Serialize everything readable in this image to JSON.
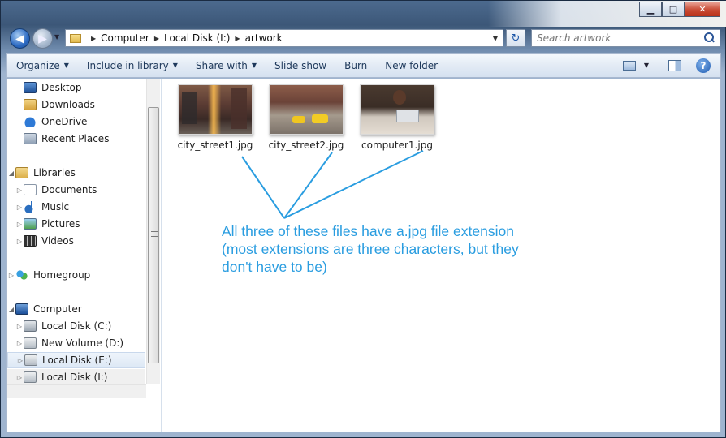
{
  "window": {
    "caption_buttons": {
      "minimize": "▁",
      "maximize": "□",
      "close": "✕"
    }
  },
  "nav": {
    "back_glyph": "◀",
    "forward_glyph": "▶",
    "address": {
      "crumbs": [
        "Computer",
        "Local Disk (I:)",
        "artwork"
      ],
      "separator": "▶"
    },
    "refresh_glyph": "↻",
    "search": {
      "placeholder": "Search artwork"
    }
  },
  "commandbar": {
    "organize": "Organize",
    "include_in_library": "Include in library",
    "share_with": "Share with",
    "slide_show": "Slide show",
    "burn": "Burn",
    "new_folder": "New folder",
    "dropdown_glyph": "▼",
    "help_glyph": "?"
  },
  "sidebar": {
    "favorites": [
      {
        "label": "Desktop",
        "icon": "desktop-icon"
      },
      {
        "label": "Downloads",
        "icon": "downloads-icon"
      },
      {
        "label": "OneDrive",
        "icon": "onedrive-icon"
      },
      {
        "label": "Recent Places",
        "icon": "recent-places-icon"
      }
    ],
    "libraries": {
      "label": "Libraries",
      "items": [
        {
          "label": "Documents",
          "icon": "documents-icon"
        },
        {
          "label": "Music",
          "icon": "music-icon"
        },
        {
          "label": "Pictures",
          "icon": "pictures-icon"
        },
        {
          "label": "Videos",
          "icon": "videos-icon"
        }
      ]
    },
    "homegroup": {
      "label": "Homegroup"
    },
    "computer": {
      "label": "Computer",
      "drives": [
        {
          "label": "Local Disk (C:)"
        },
        {
          "label": "New Volume (D:)"
        },
        {
          "label": "Local Disk (E:)",
          "state": "hover"
        },
        {
          "label": "Local Disk (I:)",
          "state": "selected"
        }
      ]
    },
    "expand_glyph": "▷",
    "expanded_glyph": "◢"
  },
  "files": [
    {
      "name": "city_street1.jpg"
    },
    {
      "name": "city_street2.jpg"
    },
    {
      "name": "computer1.jpg"
    }
  ],
  "annotation": {
    "lines": [
      "All three of these files have a.jpg file extension",
      "(most extensions are three characters, but they",
      "don't have to be)"
    ],
    "color": "#2a9de0"
  }
}
